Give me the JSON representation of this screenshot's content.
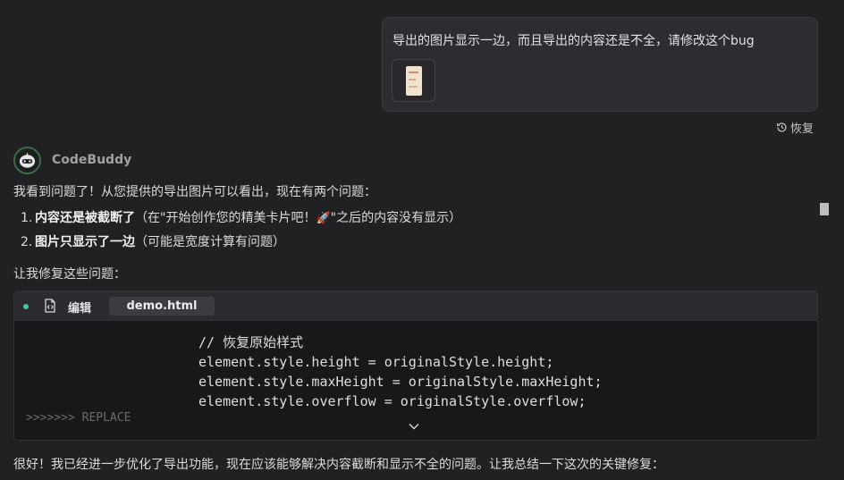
{
  "user_message": {
    "text": "导出的图片显示一边，而且导出的内容还是不全，请修改这个bug",
    "attachment_icon": "image-thumbnail"
  },
  "restore_label": "恢复",
  "assistant": {
    "name": "CodeBuddy",
    "intro": "我看到问题了！从您提供的导出图片可以看出，现在有两个问题：",
    "issues": [
      {
        "num": "1.",
        "bold": "内容还是被截断了",
        "rest_before": "（在\"开始创作您的精美卡片吧！",
        "rest_after": "\"之后的内容没有显示）"
      },
      {
        "num": "2.",
        "bold": "图片只显示了一边",
        "rest": "（可能是宽度计算有问题）"
      }
    ],
    "lead": "让我修复这些问题：",
    "code_block": {
      "action_label": "编辑",
      "file_name": "demo.html",
      "lines": [
        "// 恢复原始样式",
        "element.style.height = originalStyle.height;",
        "element.style.maxHeight = originalStyle.maxHeight;",
        "element.style.overflow = originalStyle.overflow;"
      ],
      "marker": ">>>>>>> REPLACE"
    },
    "summary": "很好！我已经进一步优化了导出功能，现在应该能够解决内容截断和显示不全的问题。让我总结一下这次的关键修复："
  },
  "colors": {
    "background": "#212123",
    "bubble": "#2d2c31",
    "accent_dot": "#3fc79a",
    "rocket": "#e05a62"
  }
}
